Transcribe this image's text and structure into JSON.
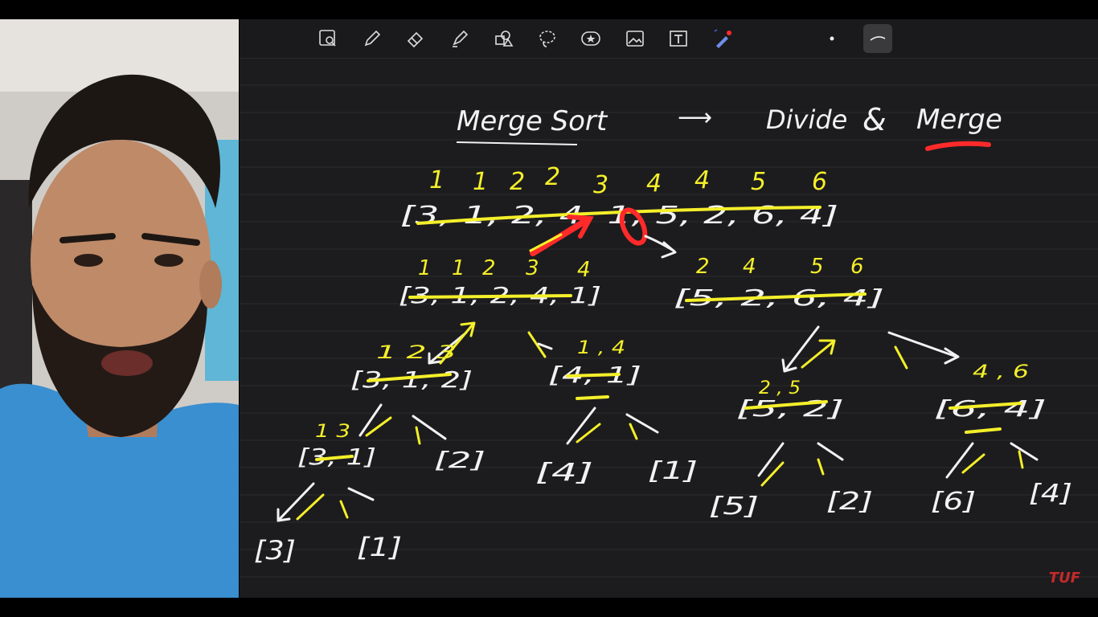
{
  "board": {
    "title": "Merge Sort",
    "arrow": "⟶",
    "subtitle_a": "Divide",
    "subtitle_amp": "&",
    "subtitle_b": "Merge",
    "top_sorted": [
      "1",
      "1",
      "2",
      "2",
      "3",
      "4",
      "4",
      "5",
      "6"
    ],
    "top_array": "[3, 1, 2, 4, 1, 5, 2, 6, 4]",
    "left_sorted": [
      "1",
      "1",
      "2",
      "3",
      "4"
    ],
    "left_array": "[3, 1, 2, 4, 1]",
    "right_sorted": [
      "2",
      "4",
      "5",
      "6"
    ],
    "right_array": "[5, 2, 6, 4]",
    "n_312_sorted": "1 2 3",
    "n_312": "[3, 1, 2]",
    "n_41_sorted": "1 , 4",
    "n_41": "[4, 1]",
    "n_52_sorted": "2 , 5",
    "n_52": "[5, 2]",
    "n_64_sorted": "4 , 6",
    "n_64": "[6, 4]",
    "n_31_sorted": "1 3",
    "n_31": "[3, 1]",
    "l_2": "[2]",
    "l_4": "[4]",
    "l_1a": "[1]",
    "l_5": "[5]",
    "l_2b": "[2]",
    "l_6": "[6]",
    "l_4b": "[4]",
    "l_3": "[3]",
    "l_1b": "[1]"
  },
  "toolbar": {
    "tools": [
      "zoom-icon",
      "pen-icon",
      "eraser-icon",
      "highlighter-icon",
      "shapes-icon",
      "lasso-icon",
      "sticker-icon",
      "image-icon",
      "text-icon",
      "laser-pointer-icon",
      "dot-icon",
      "stroke-style-icon"
    ],
    "ink_color": "#f4ef2a",
    "laser_color": "#ff2222"
  },
  "watermark": "TUF"
}
